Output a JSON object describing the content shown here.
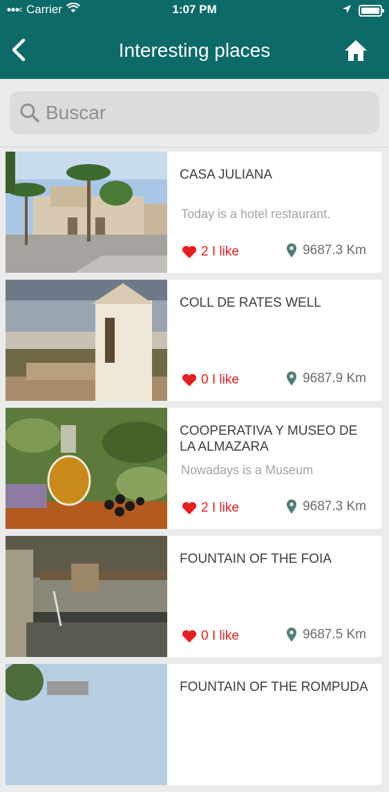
{
  "status_bar": {
    "carrier": "Carrier",
    "time": "1:07 PM"
  },
  "header": {
    "title": "Interesting places"
  },
  "search": {
    "placeholder": "Buscar"
  },
  "places": [
    {
      "name": "CASA JULIANA",
      "description": "Today is a hotel restaurant.",
      "likes": "2 I like",
      "distance": "9687.3 Km"
    },
    {
      "name": "COLL DE RATES WELL",
      "description": "",
      "likes": "0 I like",
      "distance": "9687.9 Km"
    },
    {
      "name": "COOPERATIVA Y MUSEO DE LA ALMAZARA",
      "description": "Nowadays is a Museum",
      "likes": "2 I like",
      "distance": "9687.3 Km"
    },
    {
      "name": "FOUNTAIN OF THE FOIA",
      "description": "",
      "likes": "0 I like",
      "distance": "9687.5 Km"
    },
    {
      "name": "FOUNTAIN OF THE ROMPUDA",
      "description": "",
      "likes": "",
      "distance": ""
    }
  ],
  "colors": {
    "brand": "#0c6b68",
    "like": "#e61e1e",
    "pin": "#4f7f78"
  }
}
